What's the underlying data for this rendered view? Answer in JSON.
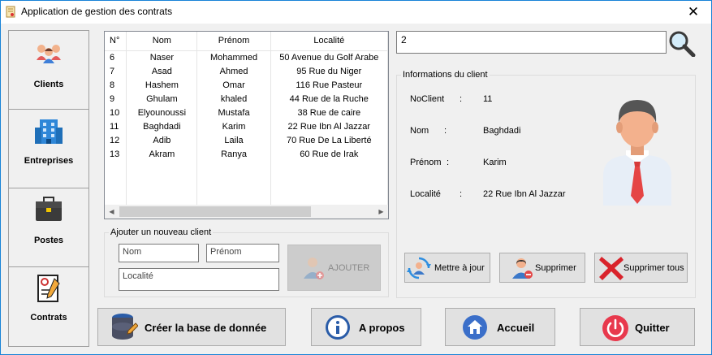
{
  "window": {
    "title": "Application de gestion des contrats",
    "close_glyph": "✕"
  },
  "sidebar": {
    "items": [
      {
        "label": "Clients",
        "icon": "people-icon"
      },
      {
        "label": "Entreprises",
        "icon": "building-icon"
      },
      {
        "label": "Postes",
        "icon": "briefcase-icon"
      },
      {
        "label": "Contrats",
        "icon": "contract-icon"
      }
    ]
  },
  "grid": {
    "columns": [
      "N°",
      "Nom",
      "Prénom",
      "Localité"
    ],
    "rows": [
      [
        "6",
        "Naser",
        "Mohammed",
        "50 Avenue du Golf Arabe"
      ],
      [
        "7",
        "Asad",
        "Ahmed",
        "95 Rue du Niger"
      ],
      [
        "8",
        "Hashem",
        "Omar",
        "116 Rue Pasteur"
      ],
      [
        "9",
        "Ghulam",
        "khaled",
        "44 Rue de la Ruche"
      ],
      [
        "10",
        "Elyounoussi",
        "Mustafa",
        "38 Rue de caire"
      ],
      [
        "11",
        "Baghdadi",
        "Karim",
        "22 Rue Ibn Al Jazzar"
      ],
      [
        "12",
        "Adib",
        "Laila",
        "70 Rue De La Liberté"
      ],
      [
        "13",
        "Akram",
        "Ranya",
        "60 Rue de Irak"
      ]
    ]
  },
  "search": {
    "value": "2"
  },
  "add_client": {
    "legend": "Ajouter un nouveau client",
    "nom_placeholder": "Nom",
    "prenom_placeholder": "Prénom",
    "localite_placeholder": "Localité",
    "add_label": "AJOUTER"
  },
  "client_info": {
    "legend": "Informations du client",
    "fields": [
      {
        "label": "NoClient",
        "sep": ":",
        "value": "11"
      },
      {
        "label": "Nom",
        "sep": ":",
        "value": "Baghdadi"
      },
      {
        "label": "Prénom",
        "sep": ":",
        "value": "Karim"
      },
      {
        "label": "Localité",
        "sep": ":",
        "value": "22 Rue Ibn Al Jazzar"
      }
    ],
    "update_label": "Mettre à jour",
    "delete_label": "Supprimer",
    "delete_all_label": "Supprimer tous"
  },
  "bottom": {
    "create_db_label": "Créer la base de donnée",
    "about_label": "A propos",
    "home_label": "Accueil",
    "quit_label": "Quitter"
  },
  "colors": {
    "accent": "#1883d7",
    "info_blue": "#2a5ca8",
    "home_blue": "#3b6fc9",
    "quit_red": "#e8394d",
    "delete_red": "#d9232b"
  }
}
